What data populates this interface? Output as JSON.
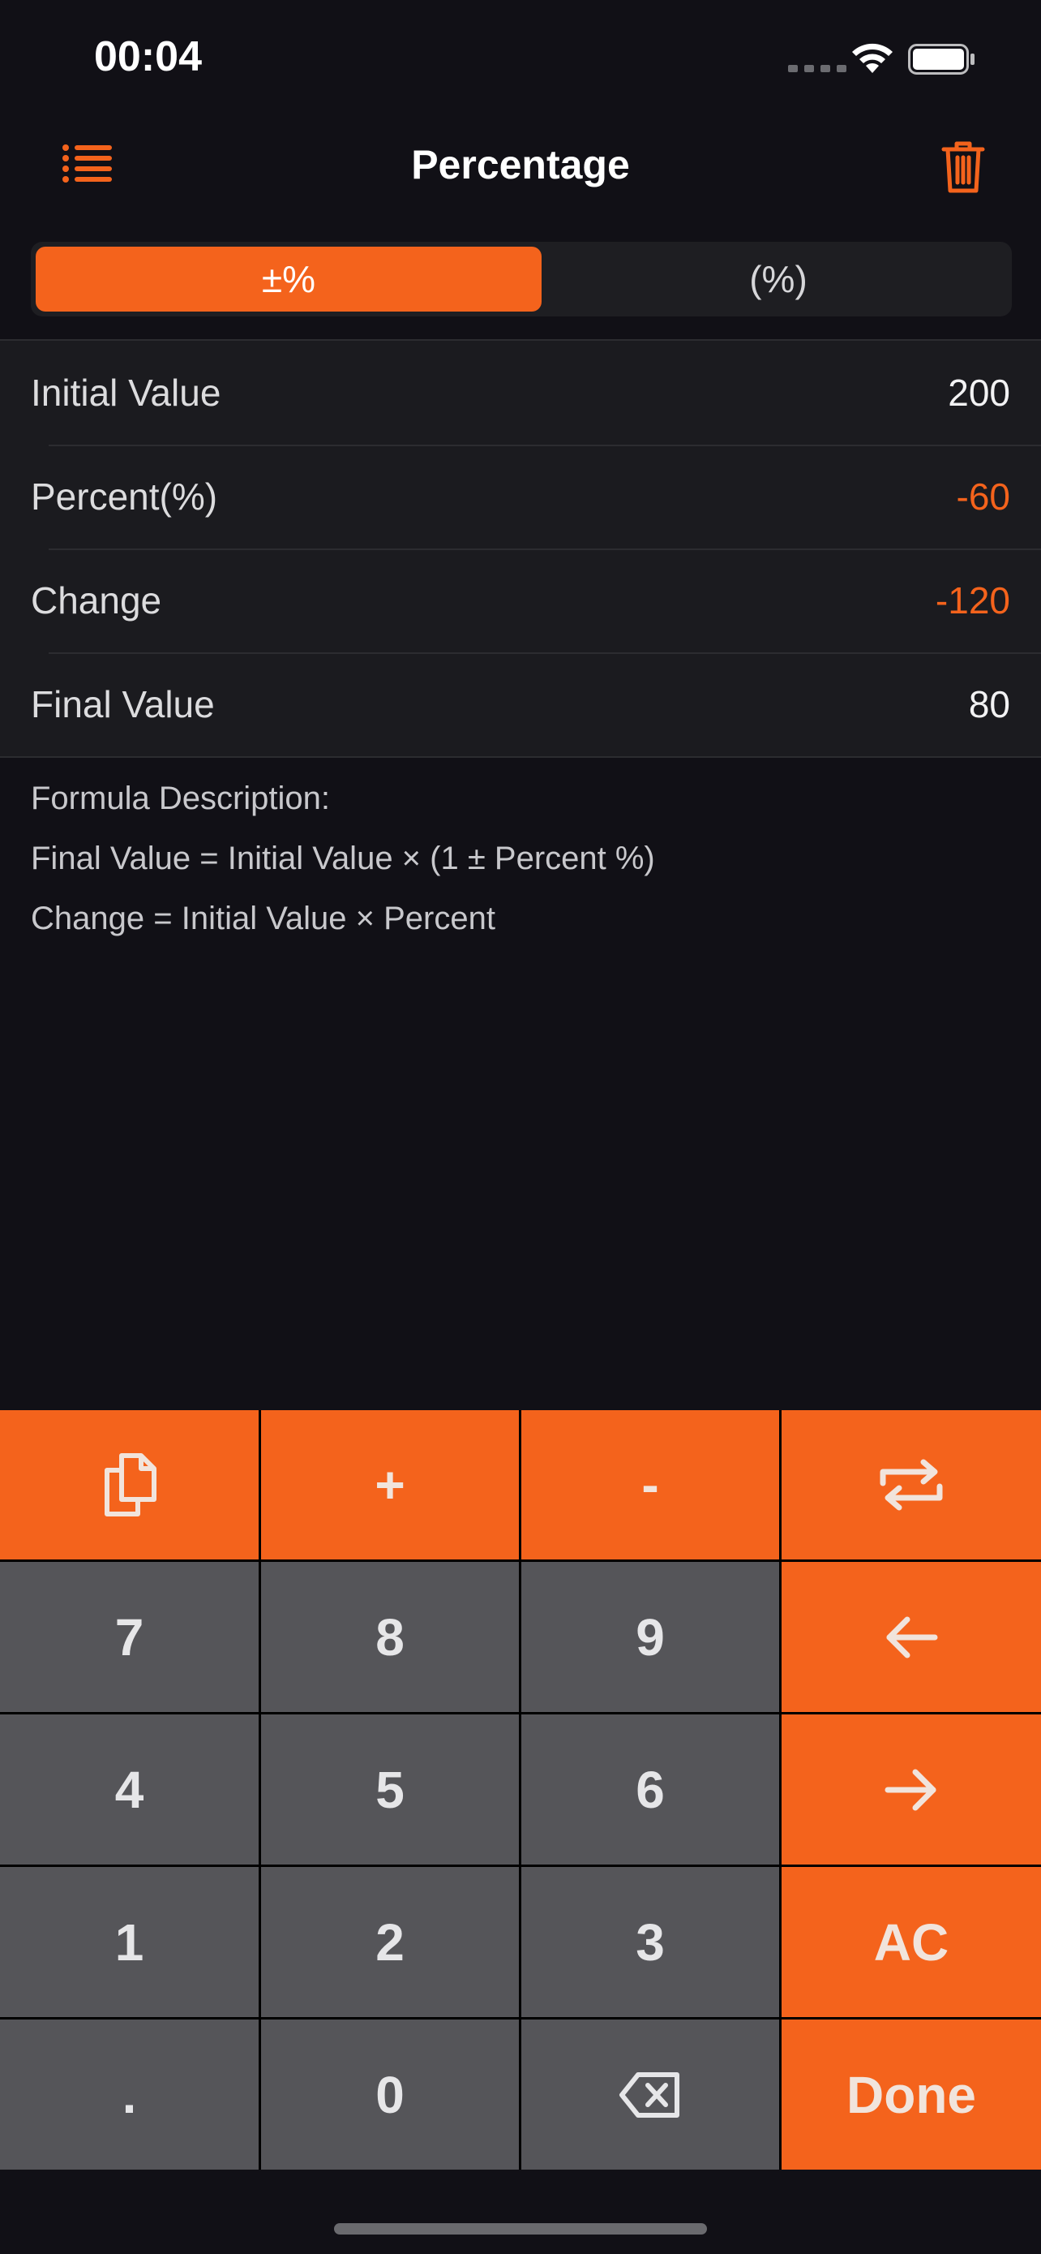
{
  "status": {
    "time": "00:04"
  },
  "nav": {
    "title": "Percentage"
  },
  "tabs": [
    {
      "label": "±%",
      "active": true
    },
    {
      "label": "(%)",
      "active": false
    }
  ],
  "rows": [
    {
      "label": "Initial Value",
      "value": "200"
    },
    {
      "label": "Percent(%)",
      "value": "-60"
    },
    {
      "label": "Change",
      "value": "-120"
    },
    {
      "label": "Final Value",
      "value": "80"
    }
  ],
  "formula": {
    "heading": "Formula Description:",
    "line1": "Final Value = Initial Value × (1 ± Percent %)",
    "line2": "Change = Initial Value × Percent"
  },
  "keys": {
    "copy": "copy-icon",
    "plus": "+",
    "minus": "-",
    "swap": "swap-icon",
    "k7": "7",
    "k8": "8",
    "k9": "9",
    "left": "left-arrow-icon",
    "k4": "4",
    "k5": "5",
    "k6": "6",
    "right": "right-arrow-icon",
    "k1": "1",
    "k2": "2",
    "k3": "3",
    "ac": "AC",
    "dot": ".",
    "k0": "0",
    "backspace": "backspace-icon",
    "done": "Done"
  },
  "colors": {
    "accent": "#f4631c",
    "background": "#111016",
    "key_gray": "#555559"
  }
}
